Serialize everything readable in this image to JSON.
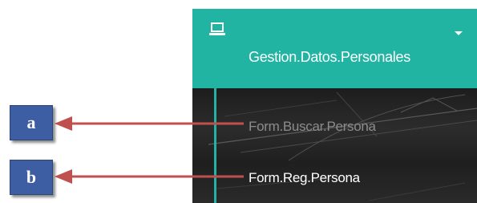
{
  "menu": {
    "icon": "laptop-icon",
    "title": "Gestion.Datos.Personales",
    "expand_icon": "caret-down-icon",
    "items": [
      {
        "label": "Form.Buscar.Persona"
      },
      {
        "label": "Form.Reg.Persona"
      }
    ]
  },
  "annotations": {
    "a": "a",
    "b": "b"
  },
  "colors": {
    "accent": "#22b4a2",
    "label_box": "#3e5ea3",
    "arrow": "#c0504d"
  }
}
